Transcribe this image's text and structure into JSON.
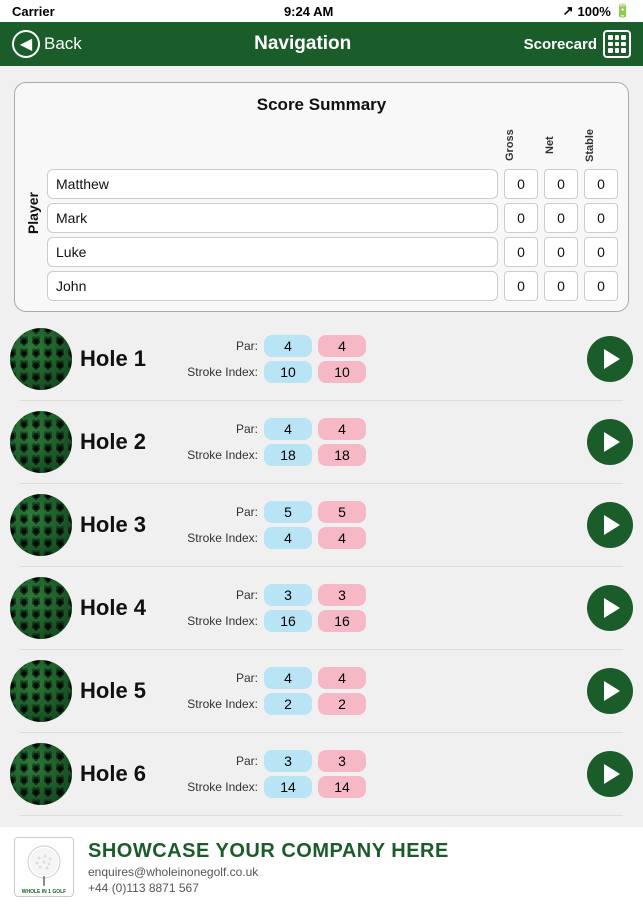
{
  "statusBar": {
    "carrier": "Carrier",
    "time": "9:24 AM",
    "signal": "▶",
    "battery": "100%"
  },
  "navBar": {
    "backLabel": "Back",
    "title": "Navigation",
    "scorecardLabel": "Scorecard"
  },
  "scoreSummary": {
    "title": "Score Summary",
    "playerLabel": "Player",
    "columnHeaders": [
      "Gross",
      "Net",
      "Stable"
    ],
    "players": [
      {
        "name": "Matthew",
        "gross": "0",
        "net": "0",
        "stable": "0"
      },
      {
        "name": "Mark",
        "gross": "0",
        "net": "0",
        "stable": "0"
      },
      {
        "name": "Luke",
        "gross": "0",
        "net": "0",
        "stable": "0"
      },
      {
        "name": "John",
        "gross": "0",
        "net": "0",
        "stable": "0"
      }
    ]
  },
  "holes": [
    {
      "name": "Hole 1",
      "parLabel": "Par:",
      "parBlue": "4",
      "parPink": "4",
      "strokeLabel": "Stroke Index:",
      "strokeBlue": "10",
      "strokePink": "10"
    },
    {
      "name": "Hole 2",
      "parLabel": "Par:",
      "parBlue": "4",
      "parPink": "4",
      "strokeLabel": "Stroke Index:",
      "strokeBlue": "18",
      "strokePink": "18"
    },
    {
      "name": "Hole 3",
      "parLabel": "Par:",
      "parBlue": "5",
      "parPink": "5",
      "strokeLabel": "Stroke Index:",
      "strokeBlue": "4",
      "strokePink": "4"
    },
    {
      "name": "Hole 4",
      "parLabel": "Par:",
      "parBlue": "3",
      "parPink": "3",
      "strokeLabel": "Stroke Index:",
      "strokeBlue": "16",
      "strokePink": "16"
    },
    {
      "name": "Hole 5",
      "parLabel": "Par:",
      "parBlue": "4",
      "parPink": "4",
      "strokeLabel": "Stroke Index:",
      "strokeBlue": "2",
      "strokePink": "2"
    },
    {
      "name": "Hole 6",
      "parLabel": "Par:",
      "parBlue": "3",
      "parPink": "3",
      "strokeLabel": "Stroke Index:",
      "strokeBlue": "14",
      "strokePink": "14"
    }
  ],
  "footer": {
    "showcase": "SHOWCASE YOUR COMPANY HERE",
    "email": "enquires@wholeinonegolf.co.uk",
    "phone": "+44 (0)113 8871 567"
  }
}
